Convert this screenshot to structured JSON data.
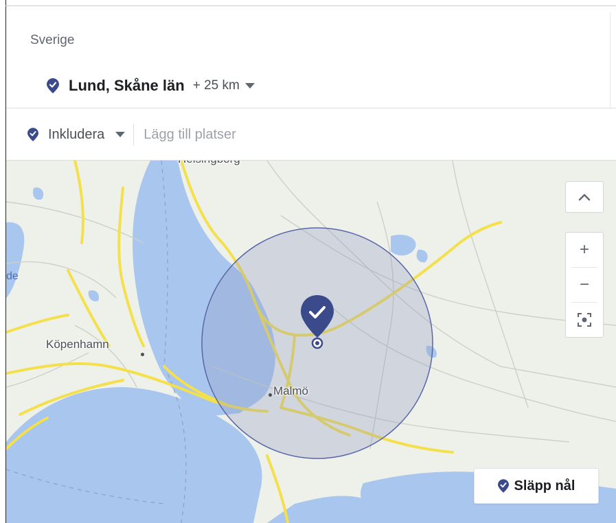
{
  "location": {
    "country": "Sverige",
    "selected_name": "Lund, Skåne län",
    "radius": "+ 25 km"
  },
  "targeting": {
    "include_label": "Inkludera",
    "add_placeholder": "Lägg till platser"
  },
  "map": {
    "cities": {
      "copenhagen": "Köpenhamn",
      "malmo": "Malmö",
      "top_partial": "Helsingborg",
      "left_partial": "de"
    },
    "controls": {
      "collapse_icon": "chevron-up-icon",
      "zoom_in": "+",
      "zoom_out": "−",
      "recenter_icon": "recenter-icon"
    },
    "drop_pin_label": "Släpp nål"
  },
  "colors": {
    "brand_pin": "#3b4a8a",
    "radius_fill": "#8f97c2",
    "water": "#a9c6ee",
    "road": "#f4e04d"
  }
}
